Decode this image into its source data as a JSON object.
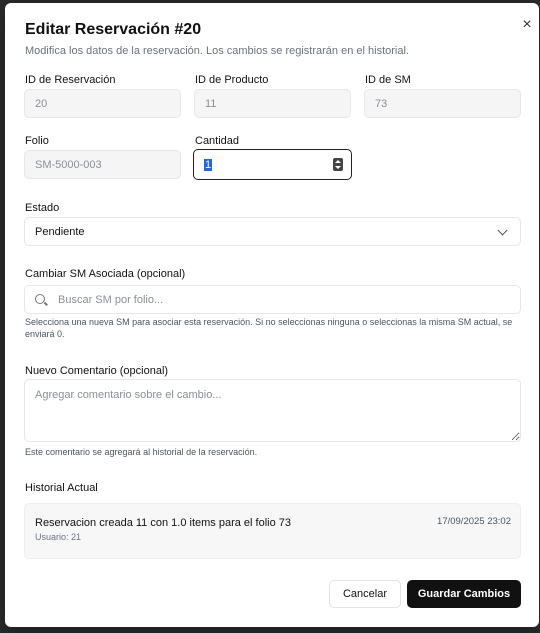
{
  "dialog": {
    "title": "Editar Reservación #20",
    "subtitle": "Modifica los datos de la reservación. Los cambios se registrarán en el historial.",
    "close_label": "×"
  },
  "fields": {
    "reservation_id": {
      "label": "ID de Reservación",
      "value": "20"
    },
    "product_id": {
      "label": "ID de Producto",
      "value": "11"
    },
    "sm_id": {
      "label": "ID de SM",
      "value": "73"
    },
    "folio": {
      "label": "Folio",
      "value": "SM-5000-003"
    },
    "quantity": {
      "label": "Cantidad",
      "value": "1"
    },
    "status": {
      "label": "Estado",
      "value": "Pendiente"
    },
    "change_sm": {
      "label": "Cambiar SM Asociada (opcional)",
      "placeholder": "Buscar SM por folio...",
      "help": "Selecciona una nueva SM para asociar esta reservación. Si no seleccionas ninguna o seleccionas la misma SM actual, se enviará 0."
    },
    "comment": {
      "label": "Nuevo Comentario (opcional)",
      "placeholder": "Agregar comentario sobre el cambio...",
      "help": "Este comentario se agregará al historial de la reservación."
    }
  },
  "history": {
    "label": "Historial Actual",
    "entries": [
      {
        "text": "Reservacion creada 11 con 1.0 items para el folio 73",
        "user": "Usuario: 21",
        "date": "17/09/2025 23:02"
      }
    ]
  },
  "actions": {
    "cancel": "Cancelar",
    "save": "Guardar Cambios"
  }
}
